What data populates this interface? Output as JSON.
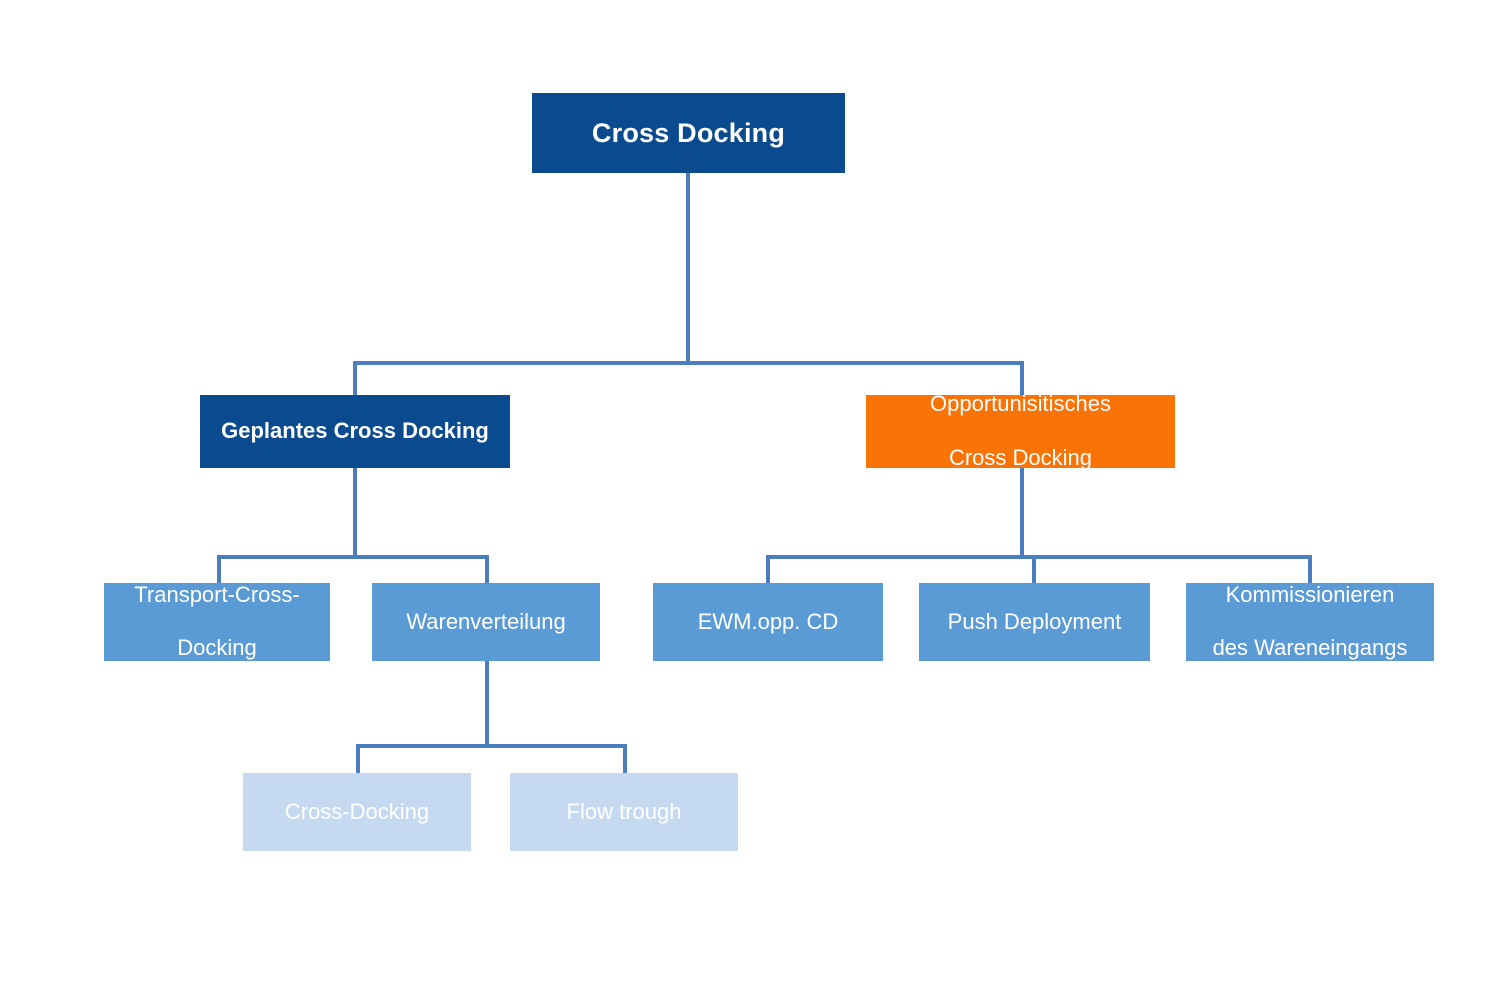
{
  "diagram": {
    "title": "Cross Docking",
    "type": "hierarchy-tree",
    "colors": {
      "dark_blue": "#0a4a8f",
      "orange": "#f97306",
      "medium_blue": "#5b9bd5",
      "light_blue": "#c5d9f0",
      "connector": "#4a7ebc",
      "background": "#ffffff",
      "text": "#ffffff"
    },
    "nodes": {
      "root": {
        "label": "Cross Docking",
        "level": 1
      },
      "planned": {
        "label": "Geplantes Cross Docking",
        "level": 2
      },
      "opportunistic": {
        "label_line1": "Opportunisitisches",
        "label_line2": "Cross Docking",
        "level": 2
      },
      "transport_cd": {
        "label_line1": "Transport-Cross-",
        "label_line2": "Docking",
        "level": 3
      },
      "warenverteilung": {
        "label": "Warenverteilung",
        "level": 3
      },
      "ewm_opp_cd": {
        "label": "EWM.opp. CD",
        "level": 3
      },
      "push_deployment": {
        "label": "Push Deployment",
        "level": 3
      },
      "kommissionieren": {
        "label_line1": "Kommissionieren",
        "label_line2": "des Wareneingangs",
        "level": 3
      },
      "cross_docking_leaf": {
        "label": "Cross-Docking",
        "level": 4
      },
      "flow_trough": {
        "label": "Flow trough",
        "level": 4
      }
    },
    "edges": [
      {
        "from": "root",
        "to": "planned"
      },
      {
        "from": "root",
        "to": "opportunistic"
      },
      {
        "from": "planned",
        "to": "transport_cd"
      },
      {
        "from": "planned",
        "to": "warenverteilung"
      },
      {
        "from": "opportunistic",
        "to": "ewm_opp_cd"
      },
      {
        "from": "opportunistic",
        "to": "push_deployment"
      },
      {
        "from": "opportunistic",
        "to": "kommissionieren"
      },
      {
        "from": "warenverteilung",
        "to": "cross_docking_leaf"
      },
      {
        "from": "warenverteilung",
        "to": "flow_trough"
      }
    ]
  }
}
